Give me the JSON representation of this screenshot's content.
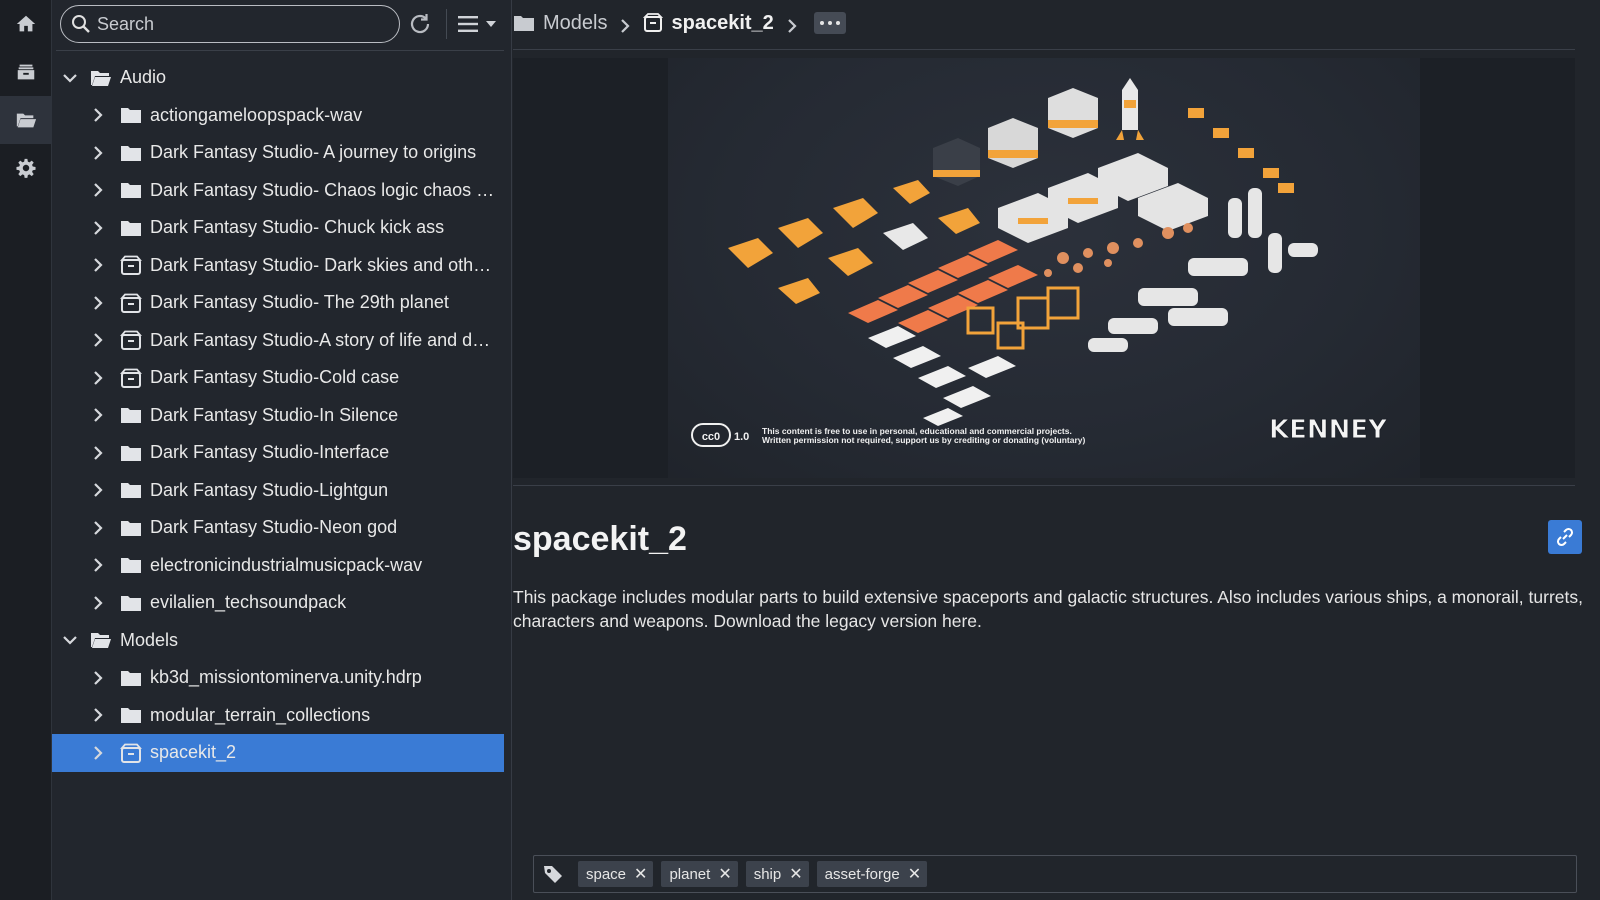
{
  "search": {
    "placeholder": "Search"
  },
  "tree": [
    {
      "label": "Audio",
      "level": 0,
      "expanded": true,
      "icon": "folder-open-icon"
    },
    {
      "label": "actiongameloopspack-wav",
      "level": 1,
      "icon": "folder-icon"
    },
    {
      "label": "Dark Fantasy Studio- A journey to origins",
      "level": 1,
      "icon": "folder-icon"
    },
    {
      "label": "Dark Fantasy Studio- Chaos logic chaos the...",
      "level": 1,
      "icon": "folder-icon"
    },
    {
      "label": "Dark Fantasy Studio- Chuck kick ass",
      "level": 1,
      "icon": "folder-icon"
    },
    {
      "label": "Dark Fantasy Studio- Dark skies and other ...",
      "level": 1,
      "icon": "package-icon"
    },
    {
      "label": "Dark Fantasy Studio- The 29th planet",
      "level": 1,
      "icon": "package-icon"
    },
    {
      "label": "Dark Fantasy Studio-A story of life and death",
      "level": 1,
      "icon": "package-icon"
    },
    {
      "label": "Dark Fantasy Studio-Cold case",
      "level": 1,
      "icon": "package-icon"
    },
    {
      "label": "Dark Fantasy Studio-In Silence",
      "level": 1,
      "icon": "folder-icon"
    },
    {
      "label": "Dark Fantasy Studio-Interface",
      "level": 1,
      "icon": "folder-icon"
    },
    {
      "label": "Dark Fantasy Studio-Lightgun",
      "level": 1,
      "icon": "folder-icon"
    },
    {
      "label": "Dark Fantasy Studio-Neon god",
      "level": 1,
      "icon": "folder-icon"
    },
    {
      "label": "electronicindustrialmusicpack-wav",
      "level": 1,
      "icon": "folder-icon"
    },
    {
      "label": "evilalien_techsoundpack",
      "level": 1,
      "icon": "folder-icon"
    },
    {
      "label": "Models",
      "level": 0,
      "expanded": true,
      "icon": "folder-open-icon"
    },
    {
      "label": "kb3d_missiontominerva.unity.hdrp",
      "level": 1,
      "icon": "folder-icon"
    },
    {
      "label": "modular_terrain_collections",
      "level": 1,
      "icon": "folder-icon"
    },
    {
      "label": "spacekit_2",
      "level": 1,
      "icon": "package-icon",
      "selected": true
    }
  ],
  "breadcrumb": {
    "parent": "Models",
    "current": "spacekit_2"
  },
  "detail": {
    "title": "spacekit_2",
    "description": "This package includes modular parts to build extensive spaceports and galactic structures. Also includes various ships, a monorail, turrets, characters and weapons. Download the legacy version here."
  },
  "preview": {
    "license_badge": "cc0",
    "license_version": "1.0",
    "license_line1": "This content is free to use in personal, educational and commercial projects.",
    "license_line2": "Written permission not required, support us by crediting or donating (voluntary)",
    "logo": "KENNEY"
  },
  "tags": [
    "space",
    "planet",
    "ship",
    "asset-forge"
  ],
  "colors": {
    "accent": "#3a7bd5",
    "background": "#21252b",
    "sidebar": "#22262d",
    "rail": "#1b1e23"
  }
}
